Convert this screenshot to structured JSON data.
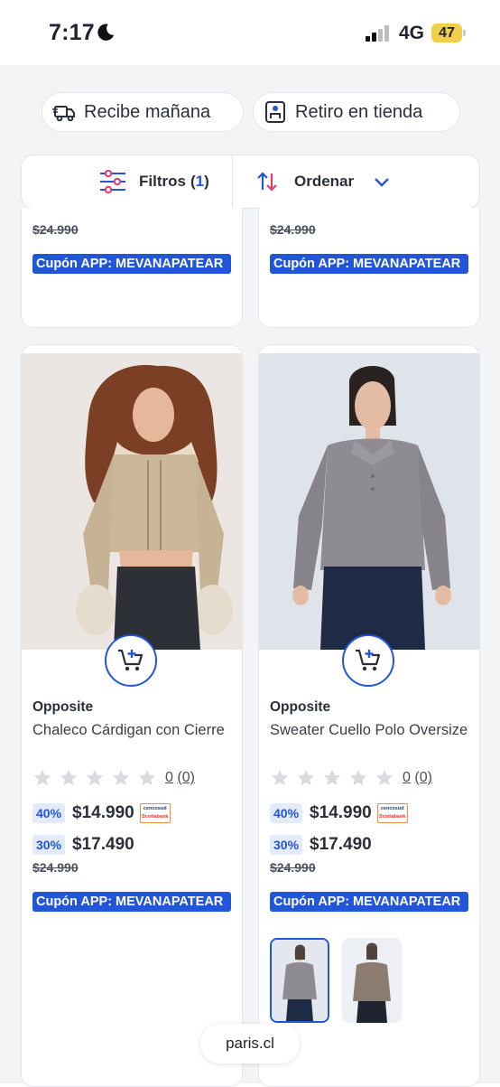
{
  "status_bar": {
    "time": "7:17",
    "network": "4G",
    "battery": "47"
  },
  "delivery": {
    "next_day": "Recibe mañana",
    "pickup": "Retiro en tienda"
  },
  "filters": {
    "label": "Filtros",
    "count_open": "(",
    "count": "1",
    "count_close": ")",
    "sort_label": "Ordenar"
  },
  "top_cards": [
    {
      "old_price": "$24.990",
      "coupon": "Cupón APP: MEVANAPATEAR"
    },
    {
      "old_price": "$24.990",
      "coupon": "Cupón APP: MEVANAPATEAR"
    }
  ],
  "products": [
    {
      "brand": "Opposite",
      "name": "Chaleco Cárdigan con Cierre",
      "rating_score": "0",
      "rating_count": "(0)",
      "discount_card": "40%",
      "price_card": "$14.990",
      "card_brand_top": "cencosud",
      "card_brand_bottom": "Scotiabank",
      "discount": "30%",
      "price": "$17.490",
      "old_price": "$24.990",
      "coupon": "Cupón APP: MEVANAPATEAR"
    },
    {
      "brand": "Opposite",
      "name": "Sweater Cuello Polo Oversize",
      "rating_score": "0",
      "rating_count": "(0)",
      "discount_card": "40%",
      "price_card": "$14.990",
      "card_brand_top": "cencosud",
      "card_brand_bottom": "Scotiabank",
      "discount": "30%",
      "price": "$17.490",
      "old_price": "$24.990",
      "coupon": "Cupón APP: MEVANAPATEAR"
    }
  ],
  "browser": {
    "url": "paris.cl"
  },
  "colors": {
    "accent": "#2156d8",
    "coupon_bg": "#2156d8",
    "discount_bg": "#e3ebfb"
  }
}
